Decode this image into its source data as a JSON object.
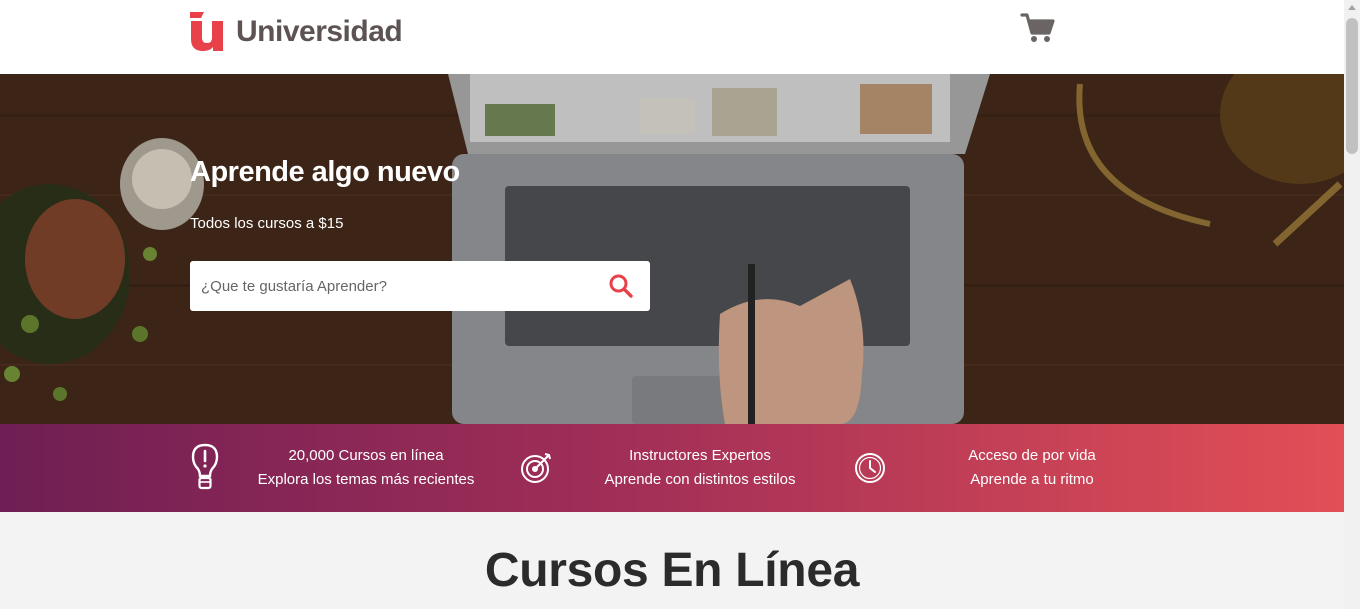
{
  "header": {
    "brand": "Universidad",
    "logo_icon": "u-logo-icon",
    "cart_icon": "shopping-cart-icon"
  },
  "hero": {
    "title": "Aprende algo nuevo",
    "subtitle": "Todos los cursos a $15",
    "search": {
      "placeholder": "¿Que te gustaría Aprender?",
      "value": "",
      "icon": "search-icon"
    }
  },
  "features": [
    {
      "icon": "lightbulb-icon",
      "line1": "20,000 Cursos en línea",
      "line2": "Explora los temas más recientes"
    },
    {
      "icon": "target-icon",
      "line1": "Instructores Expertos",
      "line2": "Aprende con distintos estilos"
    },
    {
      "icon": "clock-icon",
      "line1": "Acceso de por vida",
      "line2": "Aprende a tu ritmo"
    }
  ],
  "section": {
    "title": "Cursos En Línea"
  },
  "colors": {
    "brand": "#e8414a",
    "brand_text": "#5c5352",
    "gradient_start": "#6f1f54",
    "gradient_end": "#e24f56"
  }
}
